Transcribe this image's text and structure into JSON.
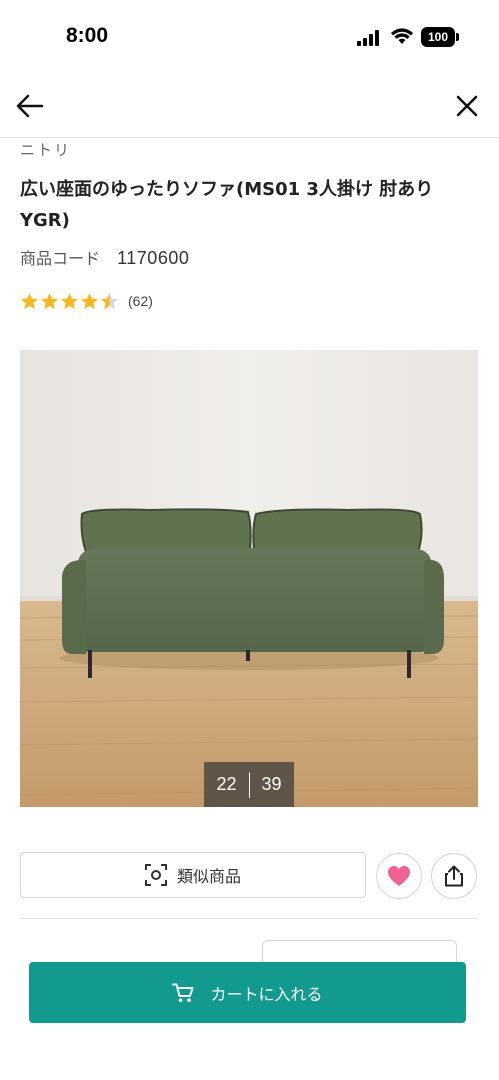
{
  "status_bar": {
    "time": "8:00",
    "battery": "100",
    "icons": [
      "signal-icon",
      "wifi-icon",
      "battery-icon"
    ]
  },
  "header": {
    "back_icon": "arrow-left-icon",
    "close_icon": "close-icon"
  },
  "product": {
    "brand": "ニトリ",
    "title": "広い座面のゆったりソファ(MS01 3人掛け 肘あり YGR)",
    "code_label": "商品コード",
    "code_value": "1170600",
    "rating_value": 4.5,
    "review_count": "(62)"
  },
  "gallery": {
    "current": "22",
    "total": "39"
  },
  "actions": {
    "similar_label": "類似商品",
    "similar_icon": "scan-icon",
    "favorite_icon": "heart-icon",
    "share_icon": "share-icon"
  },
  "cart": {
    "label": "カートに入れる",
    "icon": "cart-icon"
  },
  "colors": {
    "accent": "#139a8f",
    "star": "#f5b820",
    "heart": "#f06292"
  }
}
